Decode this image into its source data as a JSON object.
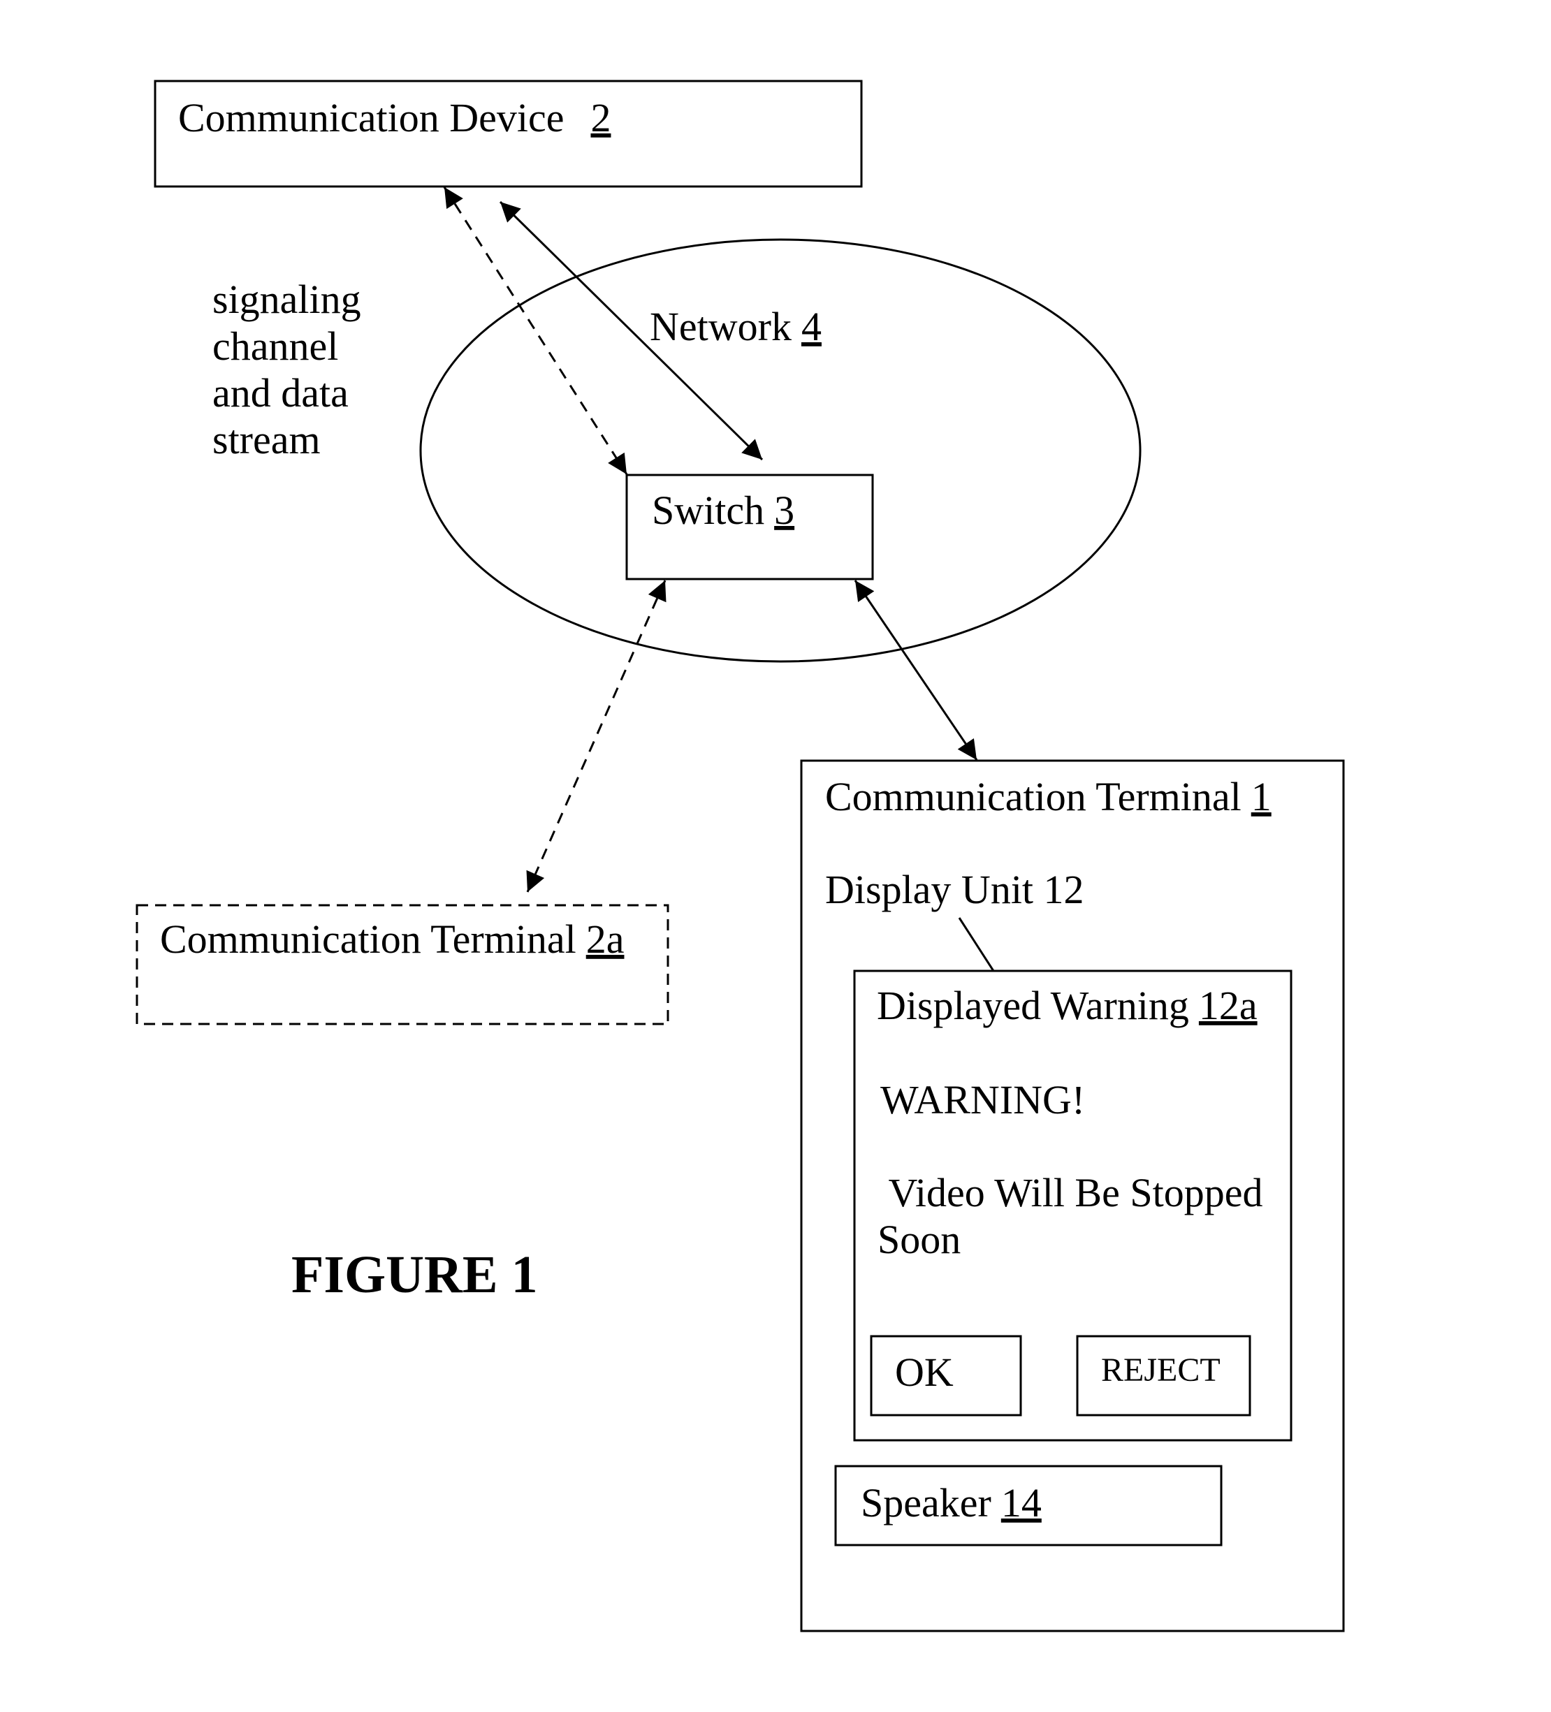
{
  "figure": {
    "caption": "FIGURE 1",
    "communication_device": {
      "label": "Communication Device",
      "ref": "2"
    },
    "network": {
      "label": "Network",
      "ref": "4"
    },
    "switch": {
      "label": "Switch",
      "ref": "3"
    },
    "terminal_2a": {
      "label": "Communication Terminal",
      "ref": "2a",
      "style": "dashed"
    },
    "signaling_note": {
      "lines": [
        "signaling",
        "channel",
        "and data",
        "stream"
      ]
    },
    "terminal_1": {
      "label": "Communication Terminal",
      "ref": "1",
      "display_unit": {
        "label": "Display Unit 12"
      },
      "displayed_warning": {
        "label": "Displayed Warning",
        "ref": "12a",
        "heading": "WARNING!",
        "message_line1": " Video Will Be Stopped",
        "message_line2": "Soon",
        "buttons": {
          "ok": "OK",
          "reject": "REJECT"
        }
      },
      "speaker": {
        "label": "Speaker",
        "ref": "14"
      }
    },
    "connections": [
      {
        "from": "Communication Device 2",
        "to": "Switch 3",
        "style": "dashed",
        "arrows": "both"
      },
      {
        "from": "Communication Device 2",
        "to": "Switch 3",
        "style": "solid",
        "arrows": "both"
      },
      {
        "from": "Switch 3",
        "to": "Communication Terminal 2a",
        "style": "dashed",
        "arrows": "both"
      },
      {
        "from": "Switch 3",
        "to": "Communication Terminal 1",
        "style": "solid",
        "arrows": "both"
      }
    ]
  }
}
